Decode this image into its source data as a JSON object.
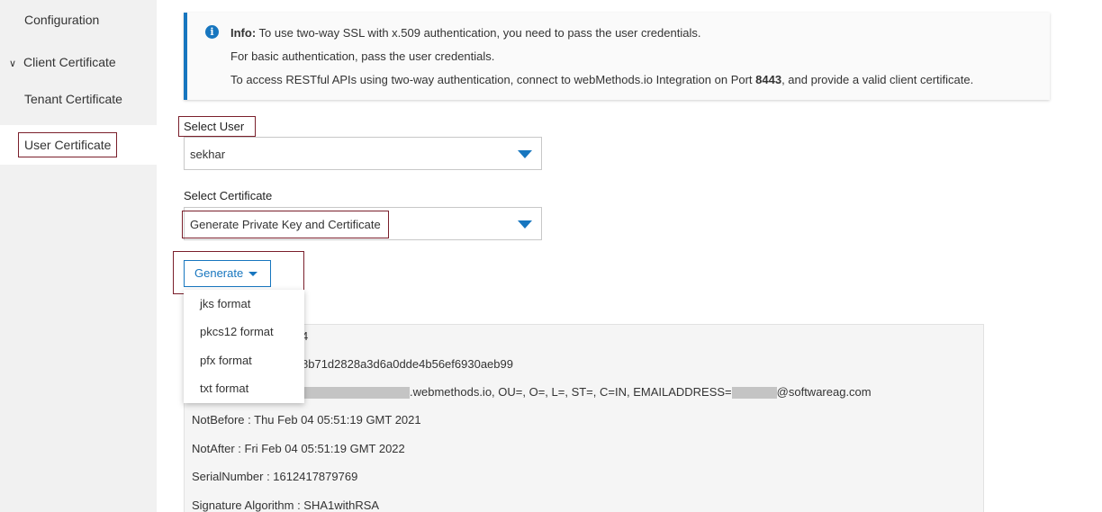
{
  "sidebar": {
    "configuration": "Configuration",
    "client_certificate": "Client Certificate",
    "tenant_certificate": "Tenant Certificate",
    "user_certificate": "User Certificate"
  },
  "info": {
    "prefix": "Info:",
    "line1": " To use two-way SSL with x.509 authentication, you need to pass the user credentials.",
    "line2": "For basic authentication, pass the user credentials.",
    "line3_start": "To access RESTful APIs using two-way authentication, connect to webMethods.io Integration on Port ",
    "port": "8443",
    "line3_end": ", and provide a valid client certificate."
  },
  "form": {
    "select_user_label": "Select User",
    "select_user_value": "sekhar",
    "select_cert_label": "Select Certificate",
    "select_cert_value": "Generate Private Key and Certificate",
    "generate_label": "Generate"
  },
  "dropdown": {
    "items": [
      "jks format",
      "pkcs12 format",
      "pfx format",
      "txt format"
    ]
  },
  "certificate": {
    "line1_tail": "4",
    "line2_tail": "8b71d2828a3d6a0dde4b56ef6930aeb99",
    "line3_mid": ".webmethods.io, OU=, O=, L=, ST=, C=IN, EMAILADDRESS=",
    "line3_end": "@softwareag.com",
    "not_before": "NotBefore : Thu Feb 04 05:51:19 GMT 2021",
    "not_after": "NotAfter : Fri Feb 04 05:51:19 GMT 2022",
    "serial": "SerialNumber : 1612417879769",
    "sig_alg": "Signature Algorithm : SHA1withRSA"
  },
  "colors": {
    "accent": "#1776bf",
    "highlight_border": "#7a1f2b",
    "sidebar_bg": "#f1f1f1"
  }
}
